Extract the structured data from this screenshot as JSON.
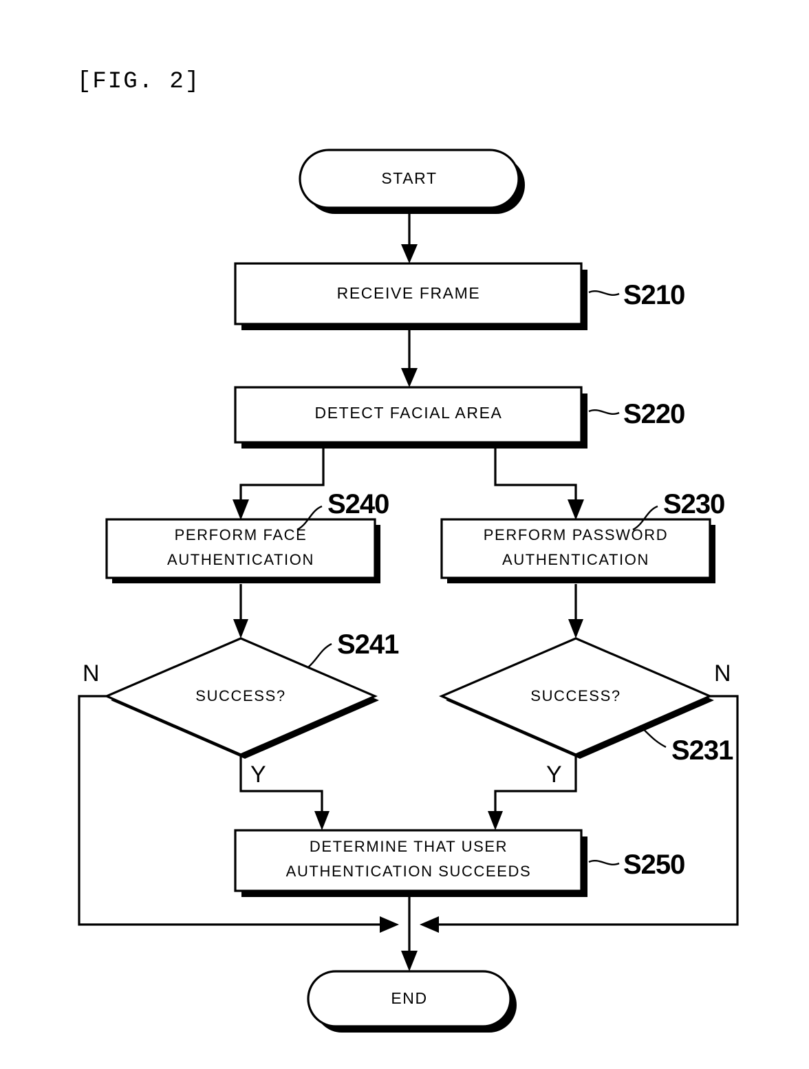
{
  "figure": {
    "label": "[FIG. 2]"
  },
  "diagram": {
    "type": "flowchart",
    "title": "User authentication flowchart",
    "nodes": {
      "start": {
        "id": "start",
        "shape": "terminator",
        "text": "START"
      },
      "s210": {
        "id": "S210",
        "shape": "process",
        "text": "RECEIVE FRAME",
        "ref": "S210"
      },
      "s220": {
        "id": "S220",
        "shape": "process",
        "text": "DETECT FACIAL AREA",
        "ref": "S220"
      },
      "s240": {
        "id": "S240",
        "shape": "process",
        "line1": "PERFORM FACE",
        "line2": "AUTHENTICATION",
        "ref": "S240"
      },
      "s230": {
        "id": "S230",
        "shape": "process",
        "line1": "PERFORM PASSWORD",
        "line2": "AUTHENTICATION",
        "ref": "S230"
      },
      "s241": {
        "id": "S241",
        "shape": "decision",
        "text": "SUCCESS?",
        "ref": "S241",
        "yes_label": "Y",
        "no_label": "N"
      },
      "s231": {
        "id": "S231",
        "shape": "decision",
        "text": "SUCCESS?",
        "ref": "S231",
        "yes_label": "Y",
        "no_label": "N"
      },
      "s250": {
        "id": "S250",
        "shape": "process",
        "line1": "DETERMINE THAT USER",
        "line2": "AUTHENTICATION SUCCEEDS",
        "ref": "S250"
      },
      "end": {
        "id": "end",
        "shape": "terminator",
        "text": "END"
      }
    },
    "edges": [
      {
        "from": "start",
        "to": "s210",
        "label": ""
      },
      {
        "from": "s210",
        "to": "s220",
        "label": ""
      },
      {
        "from": "s220",
        "to": "s240",
        "label": ""
      },
      {
        "from": "s220",
        "to": "s230",
        "label": ""
      },
      {
        "from": "s240",
        "to": "s241",
        "label": ""
      },
      {
        "from": "s230",
        "to": "s231",
        "label": ""
      },
      {
        "from": "s241",
        "to": "s250",
        "label": "Y"
      },
      {
        "from": "s241",
        "to": "end",
        "label": "N"
      },
      {
        "from": "s231",
        "to": "s250",
        "label": "Y"
      },
      {
        "from": "s231",
        "to": "end",
        "label": "N"
      },
      {
        "from": "s250",
        "to": "end",
        "label": ""
      }
    ],
    "colors": {
      "stroke": "#000000",
      "fill": "#ffffff",
      "shadow": "#000000"
    }
  }
}
